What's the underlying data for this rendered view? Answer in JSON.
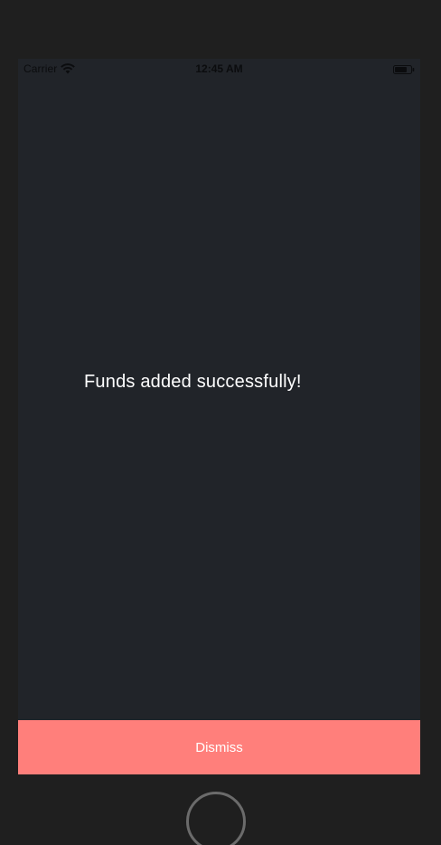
{
  "status_bar": {
    "carrier": "Carrier",
    "time": "12:45 AM",
    "wifi_icon": "wifi-icon",
    "battery_icon": "battery-icon"
  },
  "main": {
    "message": "Funds added successfully!"
  },
  "actions": {
    "dismiss_label": "Dismiss"
  },
  "colors": {
    "screen_bg": "#212429",
    "device_bg": "#1f1f1f",
    "dismiss_bg": "#ff7f7b",
    "text": "#ffffff"
  }
}
